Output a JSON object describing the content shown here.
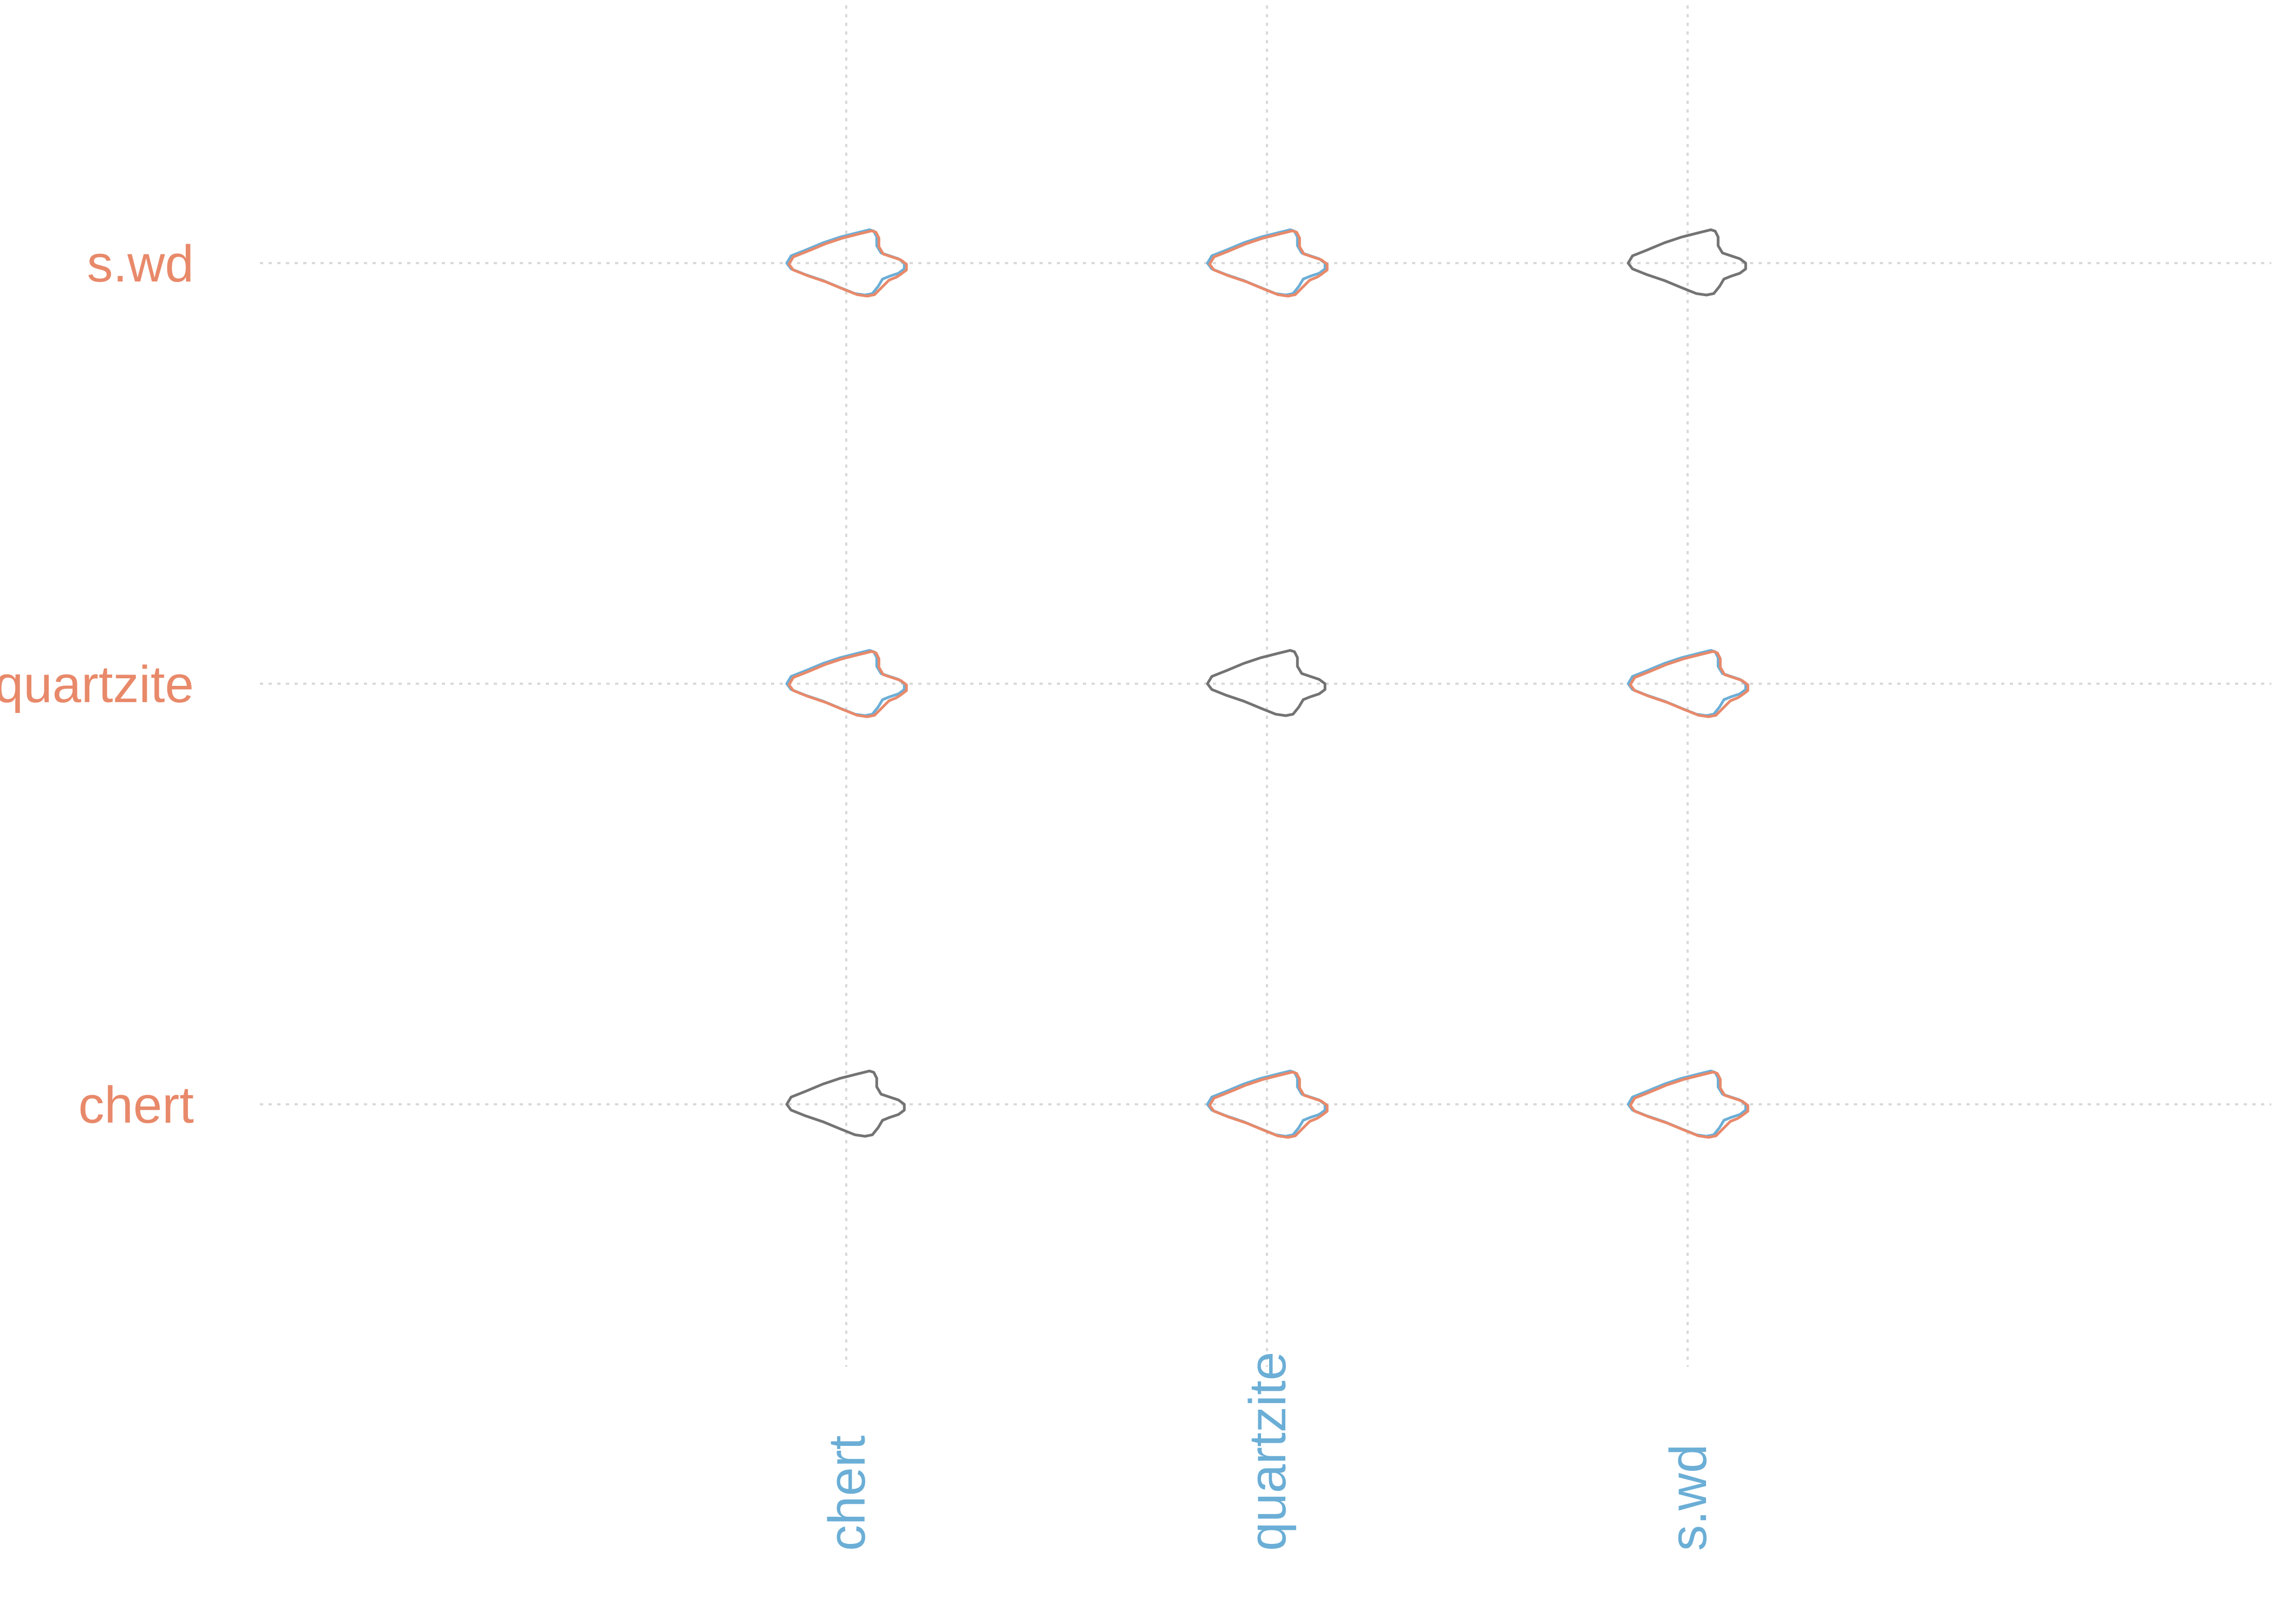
{
  "chart_data": {
    "type": "shape-comparison-matrix",
    "title": "",
    "xlabel": "",
    "ylabel": "",
    "grid": true,
    "rows": [
      "s.wd",
      "quartzite",
      "chert"
    ],
    "columns": [
      "chert",
      "quartzite",
      "s.wd"
    ],
    "colors": {
      "row": "#E8896A",
      "column": "#6BAED6",
      "diagonal": "#737373",
      "grid": "#D9D9D9"
    },
    "cells": [
      {
        "row": "s.wd",
        "column": "chert",
        "overlay": true
      },
      {
        "row": "s.wd",
        "column": "quartzite",
        "overlay": true
      },
      {
        "row": "s.wd",
        "column": "s.wd",
        "overlay": false
      },
      {
        "row": "quartzite",
        "column": "chert",
        "overlay": true
      },
      {
        "row": "quartzite",
        "column": "quartzite",
        "overlay": false
      },
      {
        "row": "quartzite",
        "column": "s.wd",
        "overlay": true
      },
      {
        "row": "chert",
        "column": "chert",
        "overlay": false
      },
      {
        "row": "chert",
        "column": "quartzite",
        "overlay": true
      },
      {
        "row": "chert",
        "column": "s.wd",
        "overlay": true
      }
    ]
  }
}
